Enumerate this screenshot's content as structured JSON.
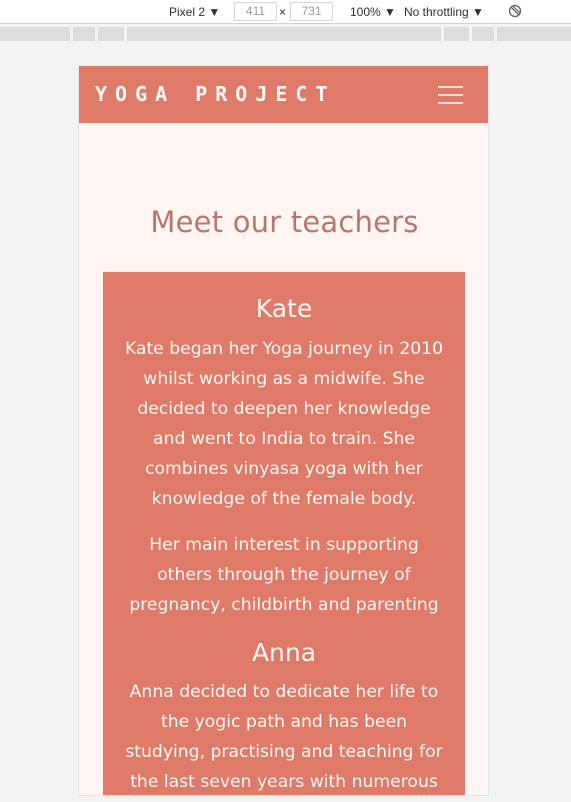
{
  "devtools": {
    "device": "Pixel 2 ▼",
    "width": "411",
    "times": "×",
    "height": "731",
    "zoom": "100% ▼",
    "throttling": "No throttling ▼",
    "rotate_icon": "rotate-icon"
  },
  "colors": {
    "navbar": "#e07a68",
    "page_bg": "#fff5f2",
    "title": "#b9776c",
    "card": "#e07a68",
    "card_text": "#fff8f5"
  },
  "navbar": {
    "brand": "YOGA PROJECT",
    "toggle_icon": "hamburger-menu-icon"
  },
  "main": {
    "title": "Meet our teachers",
    "teachers": [
      {
        "name": "Kate",
        "bio": [
          "Kate began her Yoga journey in 2010 whilst working as a midwife. She decided to deepen her knowledge and went to India to train. She combines vinyasa yoga with her knowledge of the female body.",
          "Her main interest in supporting others through the journey of pregnancy, childbirth and parenting"
        ]
      },
      {
        "name": "Anna",
        "bio": [
          "Anna decided to dedicate her life to the yogic path and has been studying, practising and teaching for the last seven years with numerous"
        ]
      }
    ]
  }
}
